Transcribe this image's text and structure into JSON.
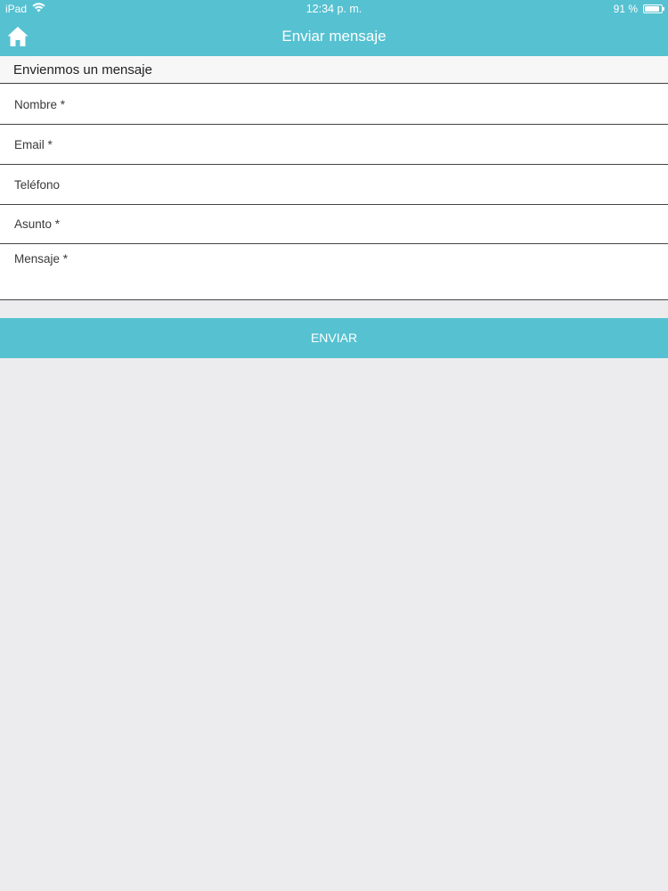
{
  "status_bar": {
    "device": "iPad",
    "time": "12:34 p. m.",
    "battery": "91 %",
    "battery_level": 0.91,
    "icons": [
      "wifi-icon",
      "battery-icon"
    ]
  },
  "nav": {
    "title": "Enviar mensaje",
    "home_icon": "home-icon"
  },
  "form": {
    "section_title": "Envienmos un mensaje",
    "fields": [
      {
        "placeholder": "Nombre *",
        "value": ""
      },
      {
        "placeholder": "Email *",
        "value": ""
      },
      {
        "placeholder": "Teléfono",
        "value": ""
      },
      {
        "placeholder": "Asunto *",
        "value": ""
      },
      {
        "placeholder": "Mensaje *",
        "value": ""
      }
    ],
    "submit_label": "ENVIAR"
  },
  "colors": {
    "accent": "#56c1d1",
    "background": "#ececef",
    "field_background": "#ffffff",
    "divider": "#444444"
  }
}
